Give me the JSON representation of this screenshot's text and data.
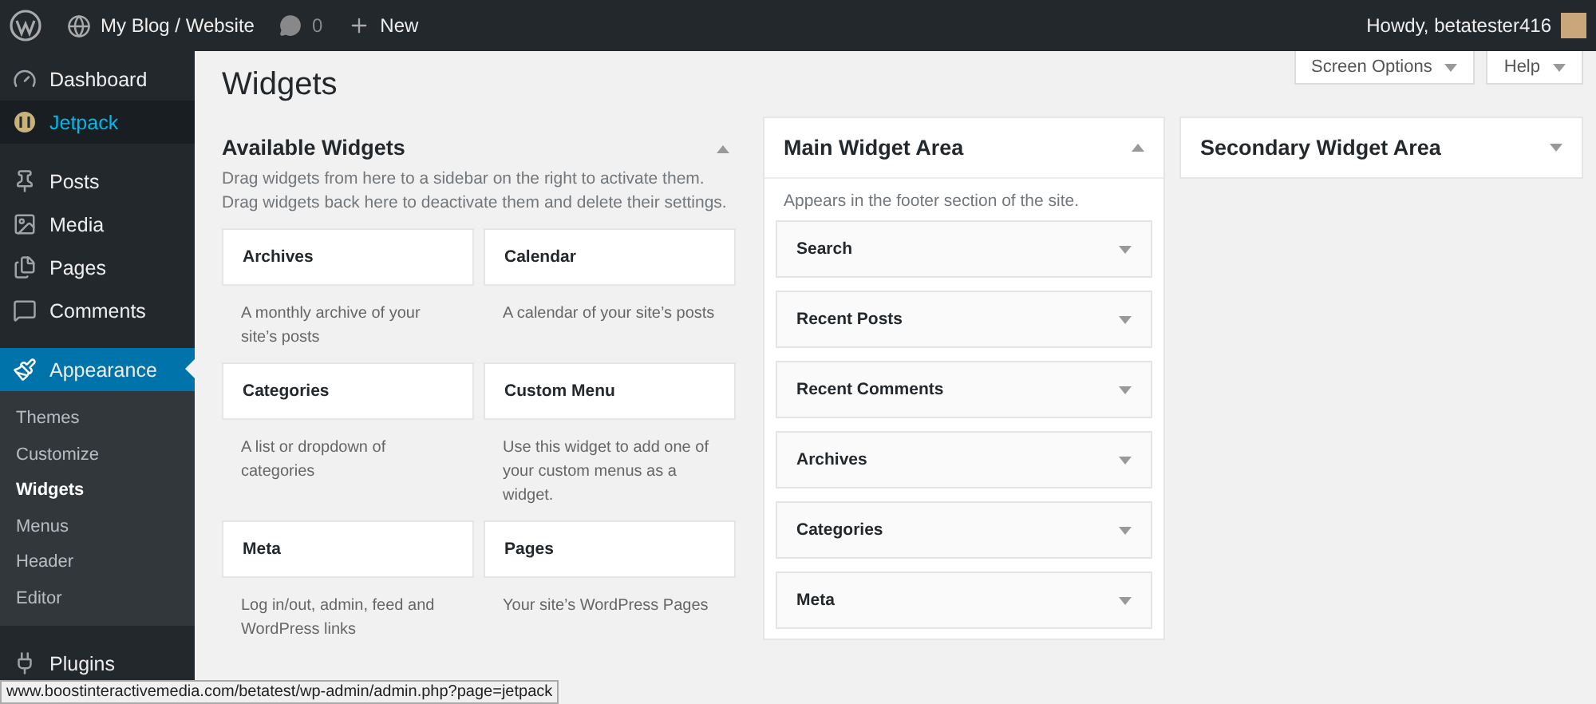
{
  "admin_bar": {
    "site_name": "My Blog / Website",
    "comments_count": "0",
    "new_label": "New",
    "greeting": "Howdy, betatester416"
  },
  "sidebar": {
    "items": [
      {
        "label": "Dashboard",
        "selected": false,
        "hovered": false
      },
      {
        "label": "Jetpack",
        "selected": false,
        "hovered": true
      },
      {
        "label": "Posts",
        "selected": false,
        "hovered": false
      },
      {
        "label": "Media",
        "selected": false,
        "hovered": false
      },
      {
        "label": "Pages",
        "selected": false,
        "hovered": false
      },
      {
        "label": "Comments",
        "selected": false,
        "hovered": false
      },
      {
        "label": "Appearance",
        "selected": true,
        "hovered": false,
        "children": [
          {
            "label": "Themes",
            "selected": false
          },
          {
            "label": "Customize",
            "selected": false
          },
          {
            "label": "Widgets",
            "selected": true
          },
          {
            "label": "Menus",
            "selected": false
          },
          {
            "label": "Header",
            "selected": false
          },
          {
            "label": "Editor",
            "selected": false
          }
        ]
      },
      {
        "label": "Plugins",
        "selected": false,
        "hovered": false
      }
    ]
  },
  "page": {
    "title": "Widgets",
    "buttons": [
      "Screen Options",
      "Help"
    ]
  },
  "available_widgets": {
    "title": "Available Widgets",
    "expanded": true,
    "description": "Drag widgets from here to a sidebar on the right to activate them. Drag widgets back here to deactivate them and delete their settings.",
    "widgets": [
      {
        "title": "Archives",
        "description": "A monthly archive of your site’s posts"
      },
      {
        "title": "Calendar",
        "description": "A calendar of your site’s posts"
      },
      {
        "title": "Categories",
        "description": "A list or dropdown of categories"
      },
      {
        "title": "Custom Menu",
        "description": "Use this widget to add one of your custom menus as a widget."
      },
      {
        "title": "Meta",
        "description": "Log in/out, admin, feed and WordPress links"
      },
      {
        "title": "Pages",
        "description": "Your site’s WordPress Pages"
      }
    ]
  },
  "sidebars": [
    {
      "title": "Main Widget Area",
      "expanded": true,
      "description": "Appears in the footer section of the site.",
      "widgets": [
        {
          "title": "Search"
        },
        {
          "title": "Recent Posts"
        },
        {
          "title": "Recent Comments"
        },
        {
          "title": "Archives"
        },
        {
          "title": "Categories"
        },
        {
          "title": "Meta"
        }
      ]
    },
    {
      "title": "Secondary Widget Area",
      "expanded": false
    }
  ],
  "status_bar": {
    "url": "www.boostinteractivemedia.com/betatest/wp-admin/admin.php?page=jetpack"
  }
}
